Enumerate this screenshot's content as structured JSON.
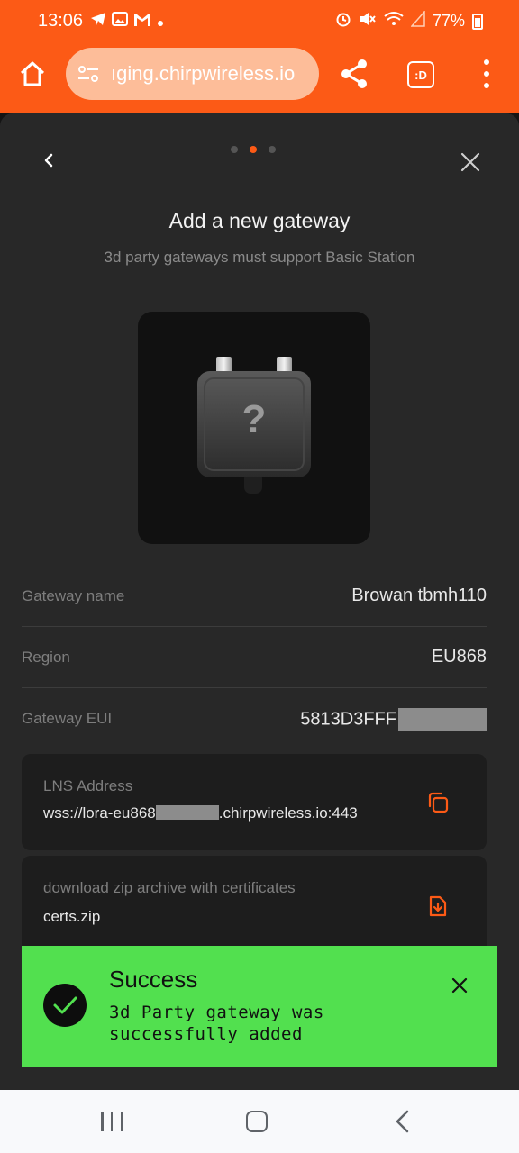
{
  "status_bar": {
    "time": "13:06",
    "battery": "77%",
    "left_icons": [
      "telegram-icon",
      "gallery-icon",
      "gmail-icon",
      "dot-icon"
    ],
    "right_icons": [
      "alarm-icon",
      "mute-icon",
      "wifi-icon",
      "signal-icon",
      "battery-icon"
    ]
  },
  "browser": {
    "url": "ıging.chirpwireless.io",
    "tabs_label": ":D"
  },
  "modal": {
    "step_index": 1,
    "step_count": 3,
    "title": "Add a new gateway",
    "subtitle": "3d party gateways must support Basic Station"
  },
  "gateway_image": {
    "glyph": "?"
  },
  "details": [
    {
      "label": "Gateway name",
      "value": "Browan tbmh110"
    },
    {
      "label": "Region",
      "value": "EU868"
    },
    {
      "label": "Gateway EUI",
      "value": "5813D3FFF"
    }
  ],
  "lns": {
    "label": "LNS Address",
    "value_prefix": "wss://lora-eu868",
    "value_suffix": ".chirpwireless.io:443"
  },
  "certs": {
    "label": "download zip archive with certificates",
    "value": "certs.zip"
  },
  "toast": {
    "title": "Success",
    "message": "3d Party gateway was successfully added"
  },
  "colors": {
    "accent": "#fc5a16",
    "toast_bg": "#52e04f",
    "modal_bg": "#282828"
  }
}
